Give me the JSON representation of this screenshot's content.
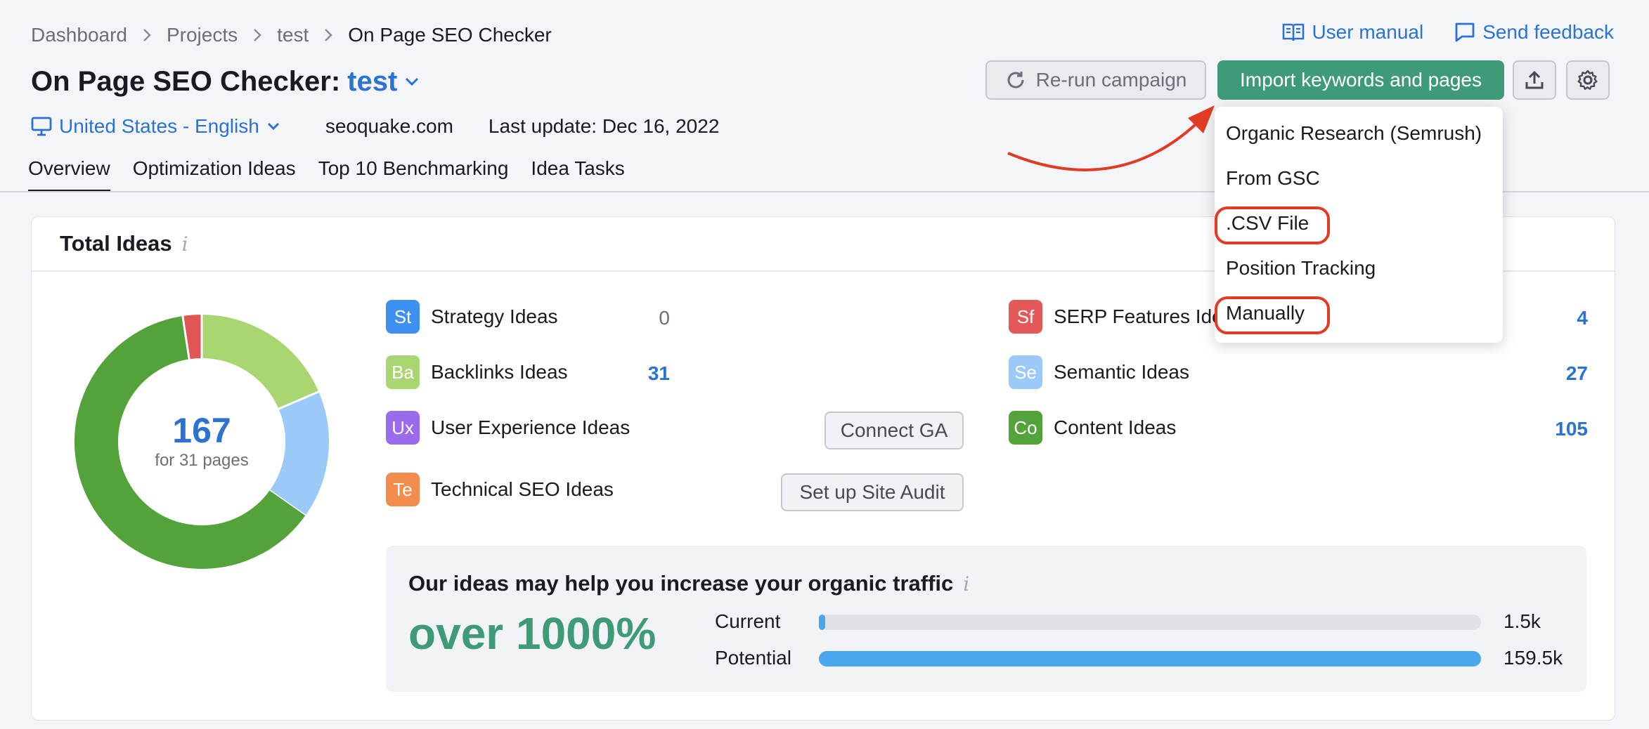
{
  "breadcrumb": [
    "Dashboard",
    "Projects",
    "test",
    "On Page SEO Checker"
  ],
  "top_links": {
    "manual": "User manual",
    "feedback": "Send feedback"
  },
  "title": {
    "prefix": "On Page SEO Checker:",
    "project": "test"
  },
  "buttons": {
    "rerun": "Re-run campaign",
    "import": "Import keywords and pages"
  },
  "meta": {
    "locale": "United States - English",
    "domain": "seoquake.com",
    "last_update": "Last update: Dec 16, 2022"
  },
  "tabs": [
    "Overview",
    "Optimization Ideas",
    "Top 10 Benchmarking",
    "Idea Tasks"
  ],
  "card": {
    "title": "Total Ideas",
    "info": "i"
  },
  "donut": {
    "total": "167",
    "subtitle": "for 31 pages",
    "slices": [
      {
        "value": 105,
        "color": "#54a33a"
      },
      {
        "value": 4,
        "color": "#e05555"
      },
      {
        "value": 31,
        "color": "#a9d672"
      },
      {
        "value": 27,
        "color": "#9ccaf8"
      }
    ]
  },
  "ideas": [
    {
      "code": "St",
      "label": "Strategy Ideas",
      "count": "0",
      "color": "#3d8ff1"
    },
    {
      "code": "Ba",
      "label": "Backlinks Ideas",
      "count": "31",
      "color": "#a9d672"
    },
    {
      "code": "Ux",
      "label": "User Experience Ideas",
      "action": "Connect GA",
      "color": "#9b6bee"
    },
    {
      "code": "Te",
      "label": "Technical SEO Ideas",
      "action": "Set up Site Audit",
      "color": "#f48c4e"
    },
    {
      "code": "Sf",
      "label": "SERP Features Ide",
      "count": "4",
      "color": "#e55858"
    },
    {
      "code": "Se",
      "label": "Semantic Ideas",
      "count": "27",
      "color": "#9ccaf8"
    },
    {
      "code": "Co",
      "label": "Content Ideas",
      "count": "105",
      "color": "#54a33a"
    }
  ],
  "traffic": {
    "title": "Our ideas may help you increase your organic traffic",
    "info": "i",
    "headline": "over 1000%",
    "rows": [
      {
        "label": "Current",
        "value": "1.5k",
        "fraction": 0.01
      },
      {
        "label": "Potential",
        "value": "159.5k",
        "fraction": 1.0
      }
    ]
  },
  "dropdown": [
    "Organic Research (Semrush)",
    "From GSC",
    ".CSV File",
    "Position Tracking",
    "Manually"
  ],
  "colors": {
    "accent": "#2b72d1",
    "import_button": "#3f9a78",
    "annotation": "#e03c24"
  }
}
